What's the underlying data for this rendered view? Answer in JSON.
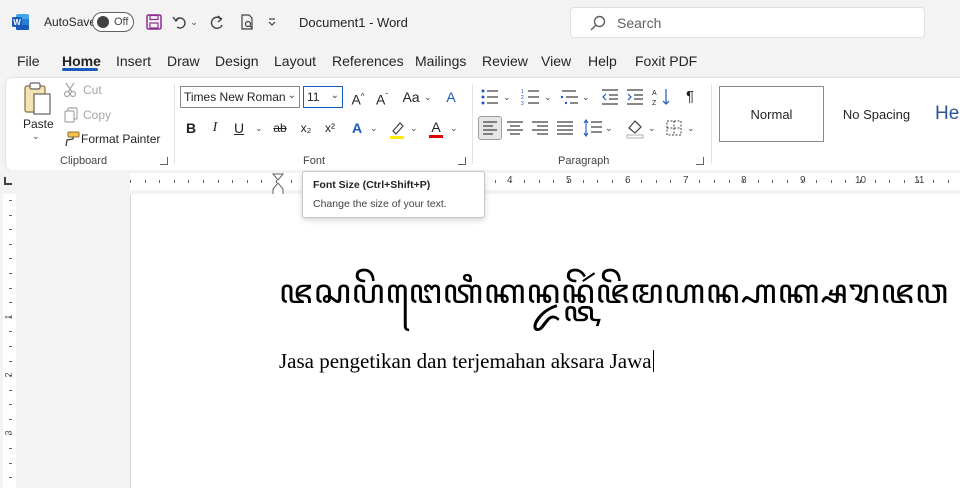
{
  "app": {
    "title": "Document1  -  Word",
    "autosave_label": "AutoSave",
    "autosave_state": "Off",
    "search_placeholder": "Search"
  },
  "menu": {
    "tabs": [
      "File",
      "Home",
      "Insert",
      "Draw",
      "Design",
      "Layout",
      "References",
      "Mailings",
      "Review",
      "View",
      "Help",
      "Foxit PDF"
    ],
    "active": "Home"
  },
  "ribbon": {
    "clipboard": {
      "label": "Clipboard",
      "paste": "Paste",
      "cut": "Cut",
      "copy": "Copy",
      "format_painter": "Format Painter"
    },
    "font": {
      "label": "Font",
      "family": "Times New Roman",
      "size": "11",
      "buttons": [
        "B",
        "I",
        "U",
        "ab",
        "x₂",
        "x²"
      ]
    },
    "paragraph": {
      "label": "Paragraph"
    },
    "styles": [
      "Normal",
      "No Spacing",
      "He"
    ]
  },
  "ruler": {
    "numbers": [
      "4",
      "5",
      "6",
      "7",
      "8",
      "9",
      "10",
      "11"
    ],
    "vertical_numbers": [
      "1",
      "1",
      "2",
      "3"
    ]
  },
  "tooltip": {
    "title": "Font Size (Ctrl+Shift+P)",
    "description": "Change the size of your text."
  },
  "document": {
    "javanese_line": "ꦗꦱꦥꦼꦔꦺꦠꦶꦏꦤ꧀ꦢꦤ꧀ꦠꦼꦂꦗꦼꦩꦲꦤ꧀ꦲꦏ꧀ꦱꦫꦗꦮ",
    "line": "Jasa pengetikan dan terjemahan aksara Jawa"
  }
}
